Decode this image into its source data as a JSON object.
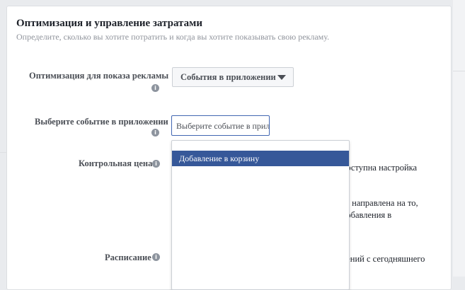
{
  "section": {
    "title": "Оптимизация и управление затратами",
    "subtitle": "Определите, сколько вы хотите потратить и когда вы хотите показывать свою рекламу."
  },
  "optimization": {
    "label": "Оптимизация для показа рекламы",
    "selected_value": "События в приложении"
  },
  "app_event": {
    "label": "Выберите событие в приложении",
    "placeholder": "Выберите событие в приложении"
  },
  "bid_control": {
    "label": "Контрольная цена",
    "partial_text": "доступна настройка"
  },
  "partial_text": {
    "line1": "ет направлена на то,",
    "line2": "добавления в",
    "line3": "лений с сегодняшнего"
  },
  "schedule": {
    "label": "Расписание"
  },
  "dropdown": {
    "options": [
      "Добавление в корзину"
    ]
  },
  "icons": {
    "info": "i"
  },
  "colors": {
    "accent": "#4267b2",
    "selected_option": "#365899"
  }
}
